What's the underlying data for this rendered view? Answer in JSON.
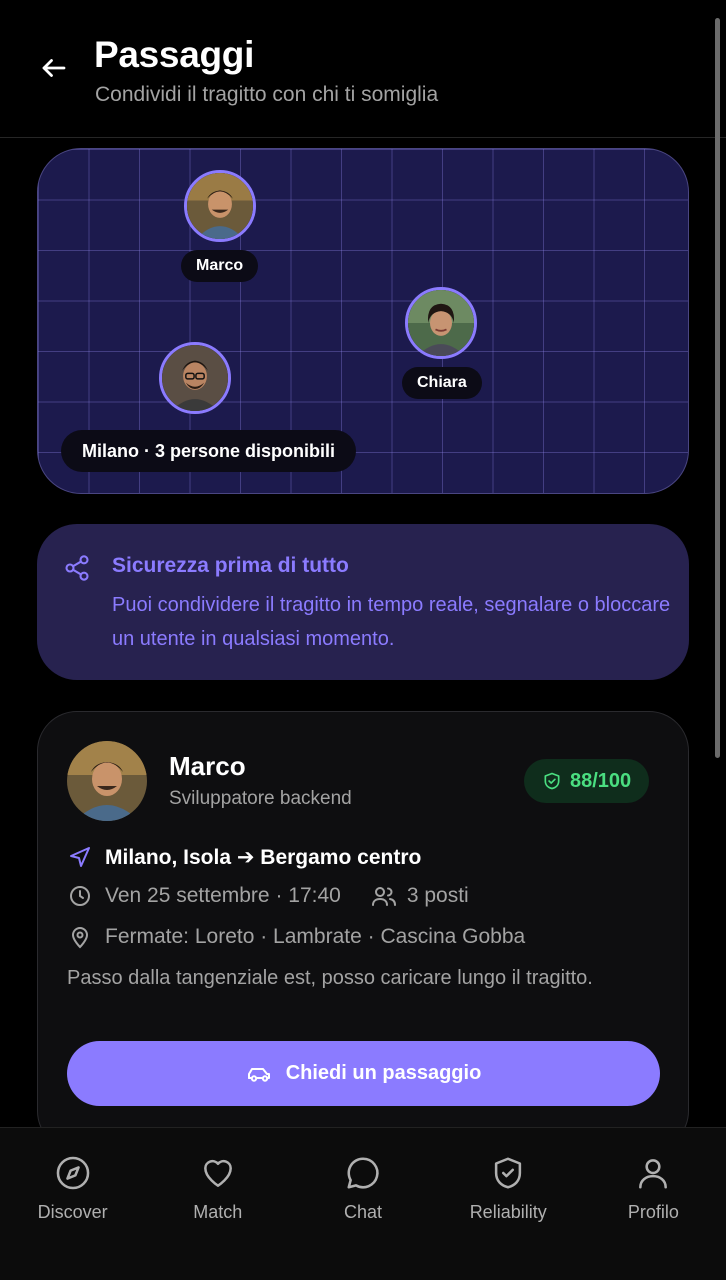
{
  "header": {
    "title": "Passaggi",
    "subtitle": "Condividi il tragitto con chi ti somiglia"
  },
  "map": {
    "people": [
      {
        "name": "Marco"
      },
      {
        "name": "Chiara"
      },
      {
        "name": ""
      }
    ],
    "status": "Milano · 3 persone disponibili"
  },
  "safety": {
    "title": "Sicurezza prima di tutto",
    "body": "Puoi condividere il tragitto in tempo reale, segnalare o bloccare un utente in qualsiasi momento."
  },
  "ride": {
    "name": "Marco",
    "role": "Sviluppatore backend",
    "score": "88/100",
    "route": "Milano, Isola ➔ Bergamo centro",
    "datetime": "Ven 25 settembre · 17:40",
    "seats": "3 posti",
    "stops": "Fermate: Loreto · Lambrate · Cascina Gobba",
    "note": "Passo dalla tangenziale est, posso caricare lungo il tragitto.",
    "cta": "Chiedi un passaggio"
  },
  "nav": [
    {
      "label": "Discover",
      "icon": "compass-icon"
    },
    {
      "label": "Match",
      "icon": "heart-icon"
    },
    {
      "label": "Chat",
      "icon": "chat-bubble-icon"
    },
    {
      "label": "Reliability",
      "icon": "shield-check-icon"
    },
    {
      "label": "Profilo",
      "icon": "user-icon"
    }
  ],
  "colors": {
    "accent": "#8b7bff",
    "map_bg": "#1c1a4d",
    "safety_bg": "#27224f",
    "score_text": "#4ade80",
    "score_bg": "#0f2d1c"
  }
}
